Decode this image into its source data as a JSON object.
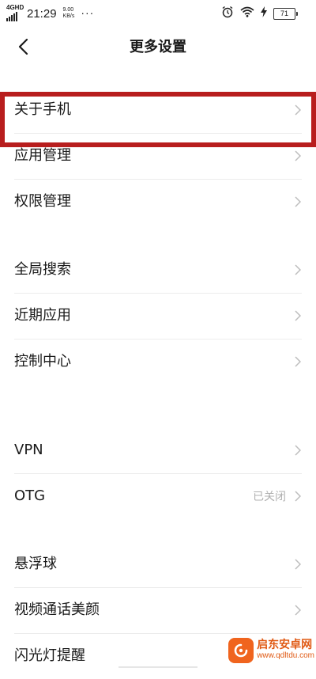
{
  "status_bar": {
    "network": "4GHD",
    "time": "21:29",
    "speed_value": "9.00",
    "speed_unit": "KB/s",
    "more": "···",
    "battery": "71"
  },
  "header": {
    "title": "更多设置"
  },
  "groups": [
    {
      "items": [
        {
          "label": "关于手机"
        },
        {
          "label": "应用管理"
        },
        {
          "label": "权限管理"
        }
      ]
    },
    {
      "items": [
        {
          "label": "全局搜索"
        },
        {
          "label": "近期应用"
        },
        {
          "label": "控制中心"
        }
      ]
    },
    {
      "items": [
        {
          "label": "VPN"
        },
        {
          "label": "OTG",
          "value": "已关闭"
        }
      ]
    },
    {
      "items": [
        {
          "label": "悬浮球"
        },
        {
          "label": "视频通话美颜"
        },
        {
          "label": "闪光灯提醒"
        }
      ]
    }
  ],
  "highlight_color": "#b81e1e",
  "watermark": {
    "name": "启东安卓网",
    "url": "www.qdltdu.com"
  }
}
